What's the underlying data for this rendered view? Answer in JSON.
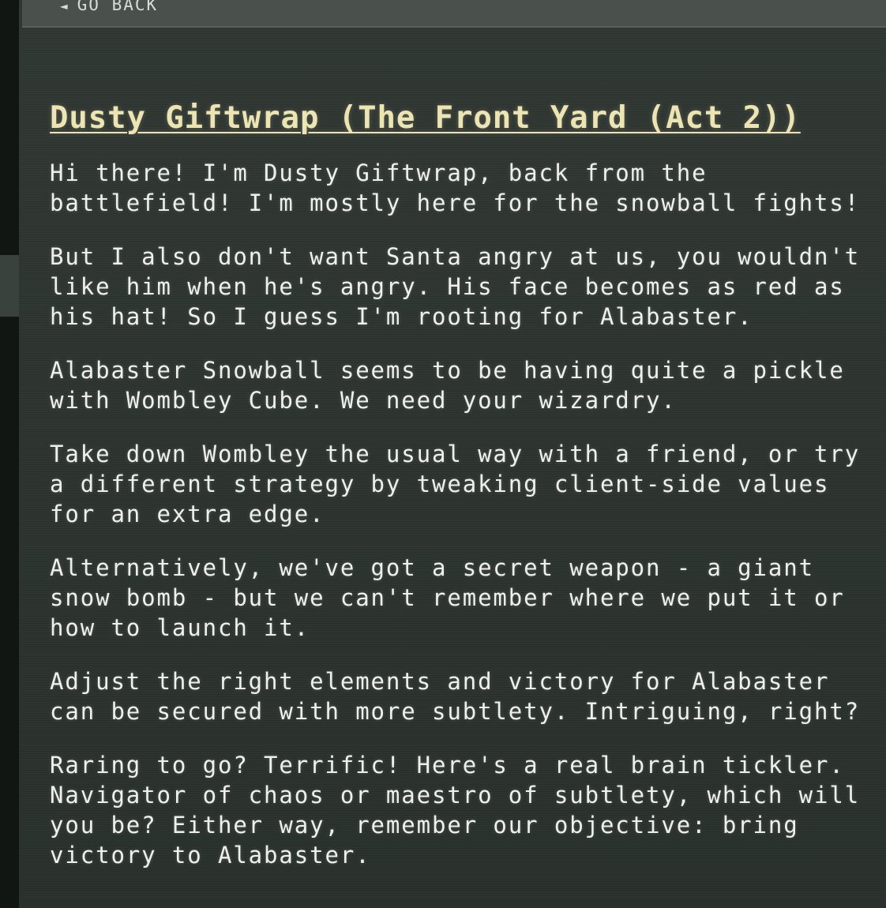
{
  "nav": {
    "back_arrow": "◄",
    "back_label": "GO BACK"
  },
  "dialog": {
    "title": "Dusty Giftwrap (The Front Yard (Act 2))",
    "paragraphs": [
      "Hi there! I'm Dusty Giftwrap, back from the\nbattlefield! I'm mostly here for the snowball fights!",
      "But I also don't want Santa angry at us, you wouldn't\nlike him when he's angry. His face becomes as red as\nhis hat! So I guess I'm rooting for Alabaster.",
      "Alabaster Snowball seems to be having quite a pickle\nwith Wombley Cube. We need your wizardry.",
      "Take down Wombley the usual way with a friend, or try\na different strategy by tweaking client-side values\nfor an extra edge.",
      "Alternatively, we've got a secret weapon - a giant\nsnow bomb - but we can't remember where we put it or\nhow to launch it.",
      "Adjust the right elements and victory for Alabaster\ncan be secured with more subtlety. Intriguing, right?",
      "Raring to go? Terrific! Here's a real brain tickler.\nNavigator of chaos or maestro of subtlety, which will\nyou be? Either way, remember our objective: bring\nvictory to Alabaster."
    ]
  },
  "colors": {
    "background": "#2a302c",
    "title": "#ece4b2",
    "text": "#eef0ec",
    "topbar": "#4a514d"
  }
}
